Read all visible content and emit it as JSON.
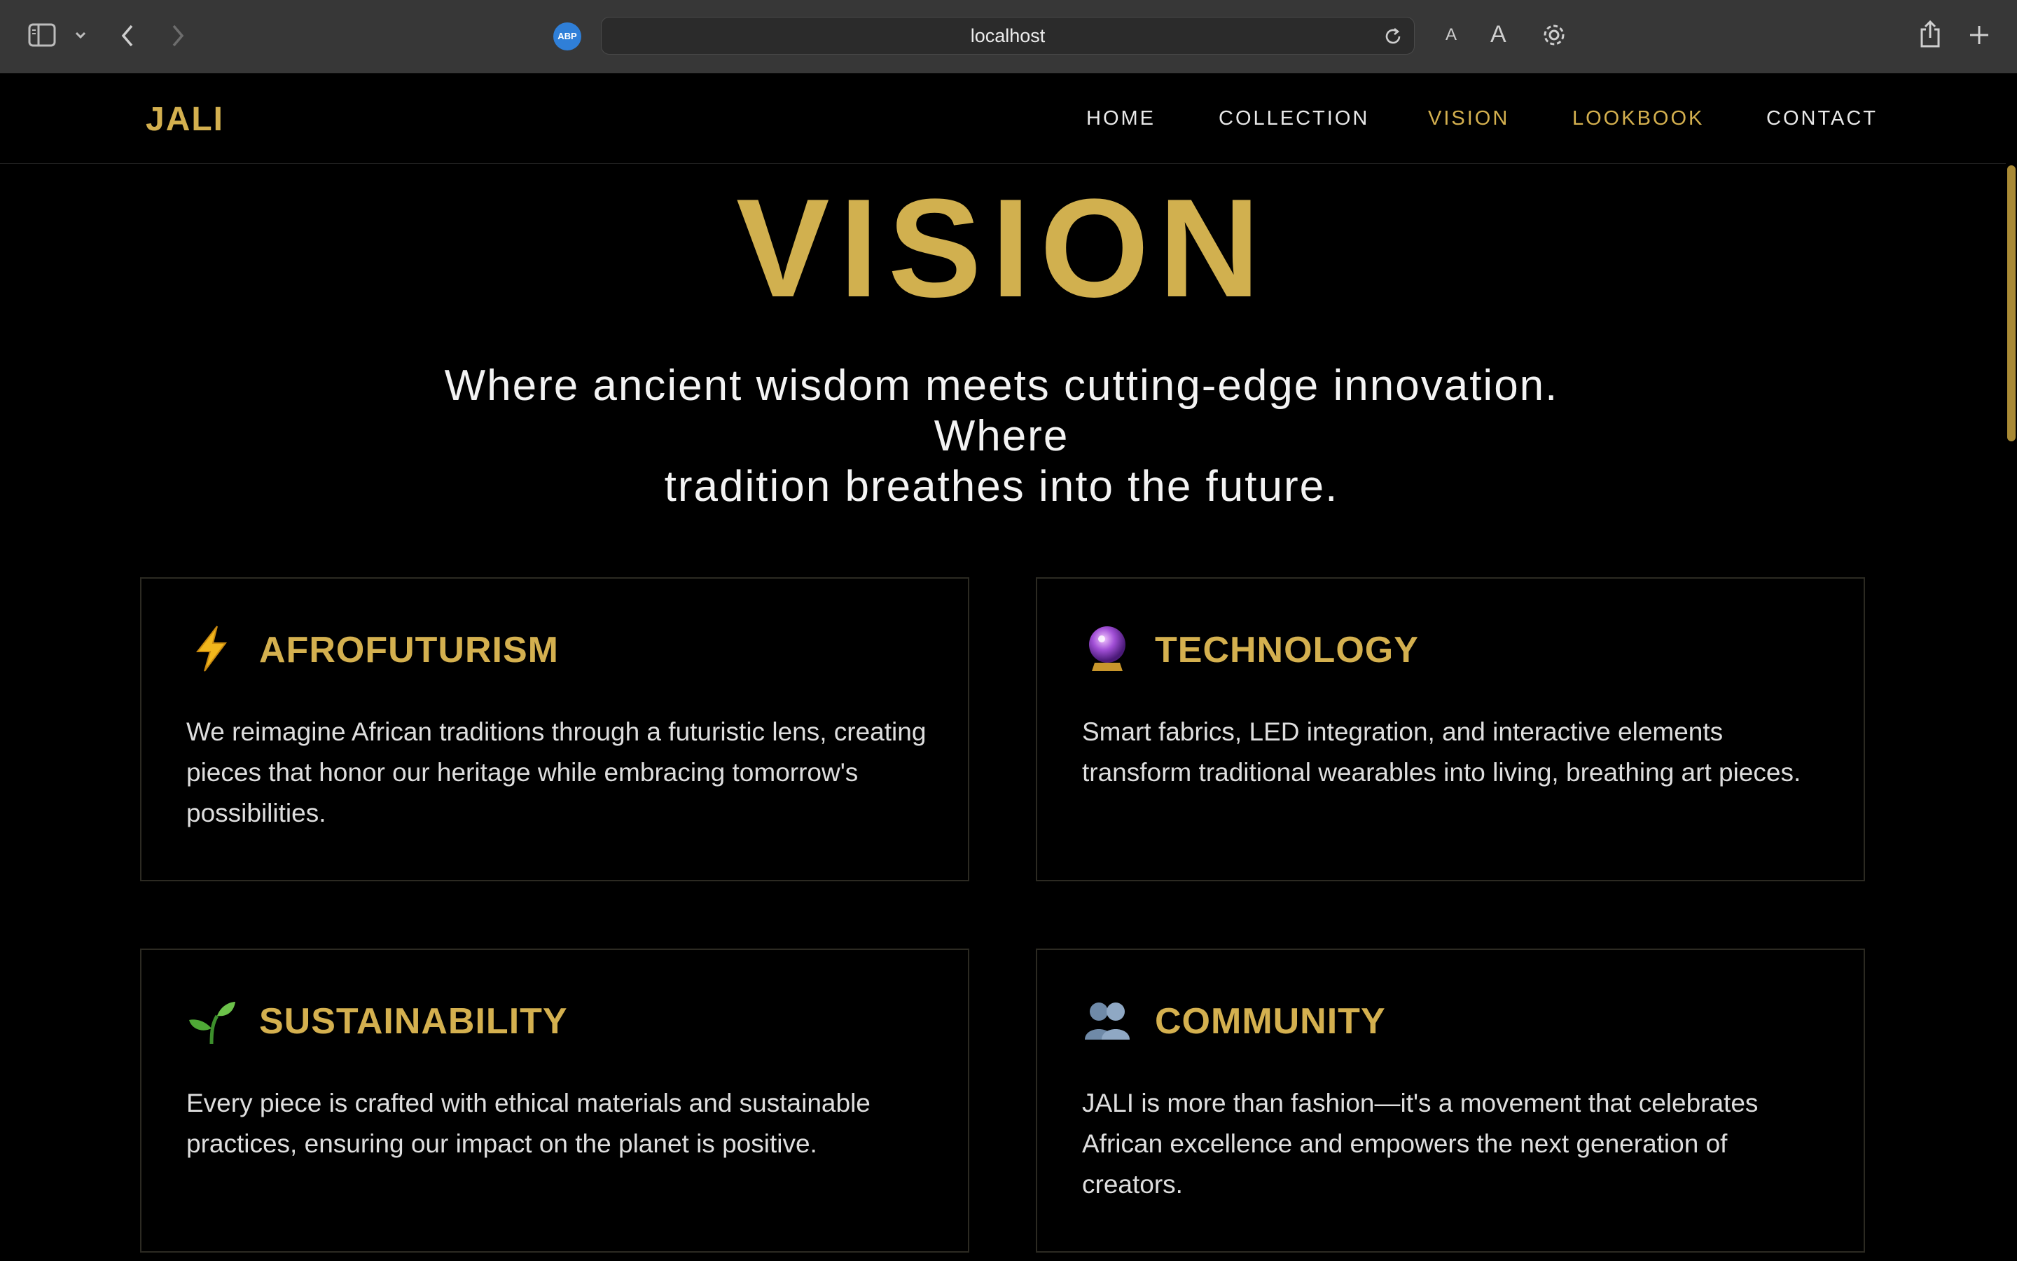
{
  "browser": {
    "url": "localhost",
    "extension_badge": "ABP",
    "icons": [
      "sidebar-icon",
      "chevron-down-icon",
      "back-icon",
      "forward-icon",
      "reload-icon",
      "text-smaller-icon",
      "text-larger-icon",
      "gear-icon",
      "share-icon",
      "plus-icon"
    ],
    "text_small": "A",
    "text_large": "A"
  },
  "nav": {
    "logo": "JALI",
    "items": [
      {
        "label": "HOME",
        "active": false
      },
      {
        "label": "COLLECTION",
        "active": false
      },
      {
        "label": "VISION",
        "active": true
      },
      {
        "label": "LOOKBOOK",
        "active": true
      },
      {
        "label": "CONTACT",
        "active": false
      }
    ]
  },
  "hero": {
    "title": "VISION",
    "subtitle_line1": "Where ancient wisdom meets cutting-edge innovation. Where",
    "subtitle_line2": "tradition breathes into the future."
  },
  "cards": [
    {
      "icon": "lightning-icon",
      "title": "AFROFUTURISM",
      "text": "We reimagine African traditions through a futuristic lens, creating pieces that honor our heritage while embracing tomorrow's possibilities."
    },
    {
      "icon": "crystal-ball-icon",
      "title": "TECHNOLOGY",
      "text": "Smart fabrics, LED integration, and interactive elements transform traditional wearables into living, breathing art pieces."
    },
    {
      "icon": "seedling-icon",
      "title": "SUSTAINABILITY",
      "text": "Every piece is crafted with ethical materials and sustainable practices, ensuring our impact on the planet is positive."
    },
    {
      "icon": "people-icon",
      "title": "COMMUNITY",
      "text": "JALI is more than fashion—it's a movement that celebrates African excellence and empowers the next generation of creators."
    }
  ],
  "colors": {
    "accent": "#d4b04f",
    "background": "#000000",
    "chrome": "#373737"
  }
}
